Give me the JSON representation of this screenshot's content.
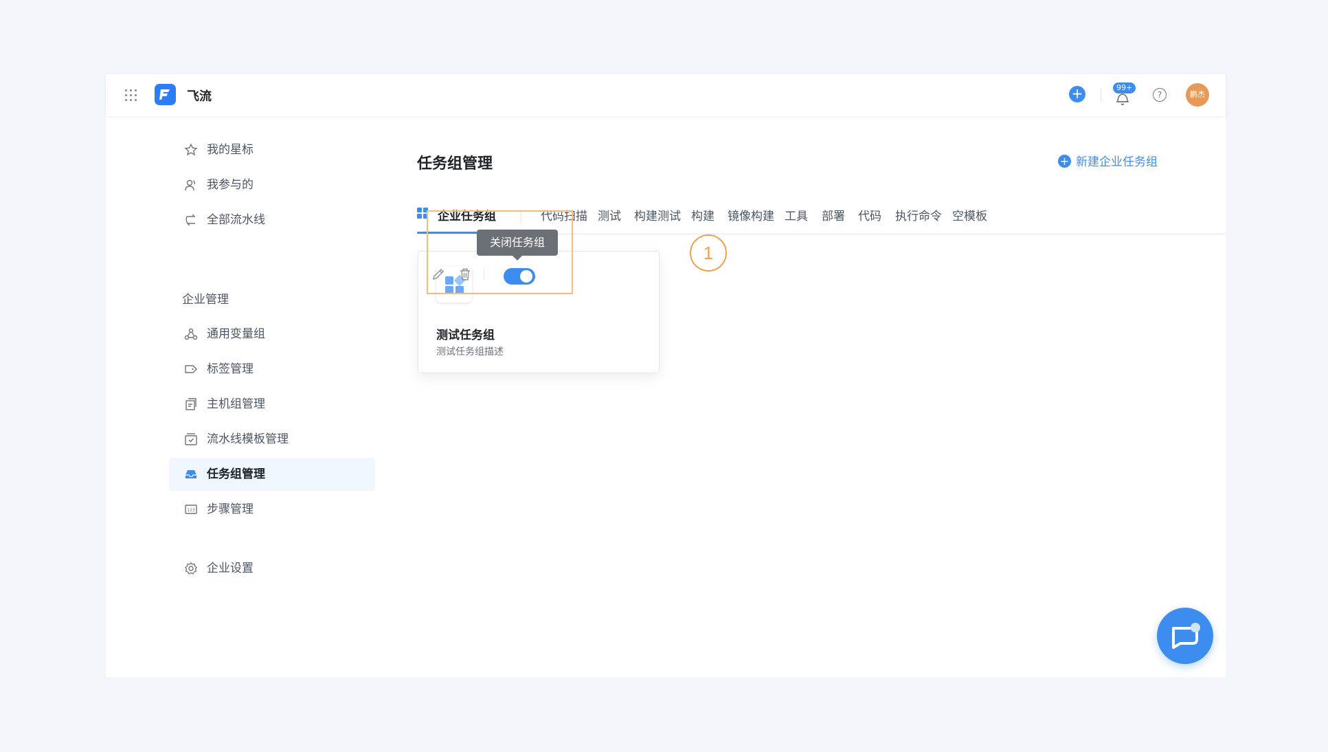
{
  "app": {
    "name": "飞流",
    "notifications_badge": "99+",
    "avatar_text": "鹏杰"
  },
  "sidebar": {
    "items_top": [
      {
        "label": "我的星标",
        "icon": "star-icon"
      },
      {
        "label": "我参与的",
        "icon": "users-icon"
      },
      {
        "label": "全部流水线",
        "icon": "pipeline-icon"
      }
    ],
    "section_label": "企业管理",
    "items_enterprise": [
      {
        "label": "通用变量组",
        "icon": "variable-group-icon"
      },
      {
        "label": "标签管理",
        "icon": "tag-icon"
      },
      {
        "label": "主机组管理",
        "icon": "host-group-icon"
      },
      {
        "label": "流水线模板管理",
        "icon": "template-icon"
      },
      {
        "label": "任务组管理",
        "icon": "inbox-icon",
        "active": true
      },
      {
        "label": "步骤管理",
        "icon": "steps-icon"
      }
    ],
    "settings_label": "企业设置"
  },
  "main": {
    "title": "任务组管理",
    "new_button": "新建企业任务组",
    "tabs": [
      "企业任务组",
      "代码扫描",
      "测试",
      "构建测试",
      "构建",
      "镜像构建",
      "工具",
      "部署",
      "代码",
      "执行命令",
      "空模板"
    ],
    "active_tab": "企业任务组"
  },
  "card": {
    "title": "测试任务组",
    "description": "测试任务组描述",
    "enabled": true
  },
  "tooltip": "关闭任务组",
  "step_marker": "1",
  "colors": {
    "accent": "#3d8cf0",
    "highlight": "#f6b97e",
    "marker": "#f2a04b",
    "avatar": "#e79a55"
  }
}
